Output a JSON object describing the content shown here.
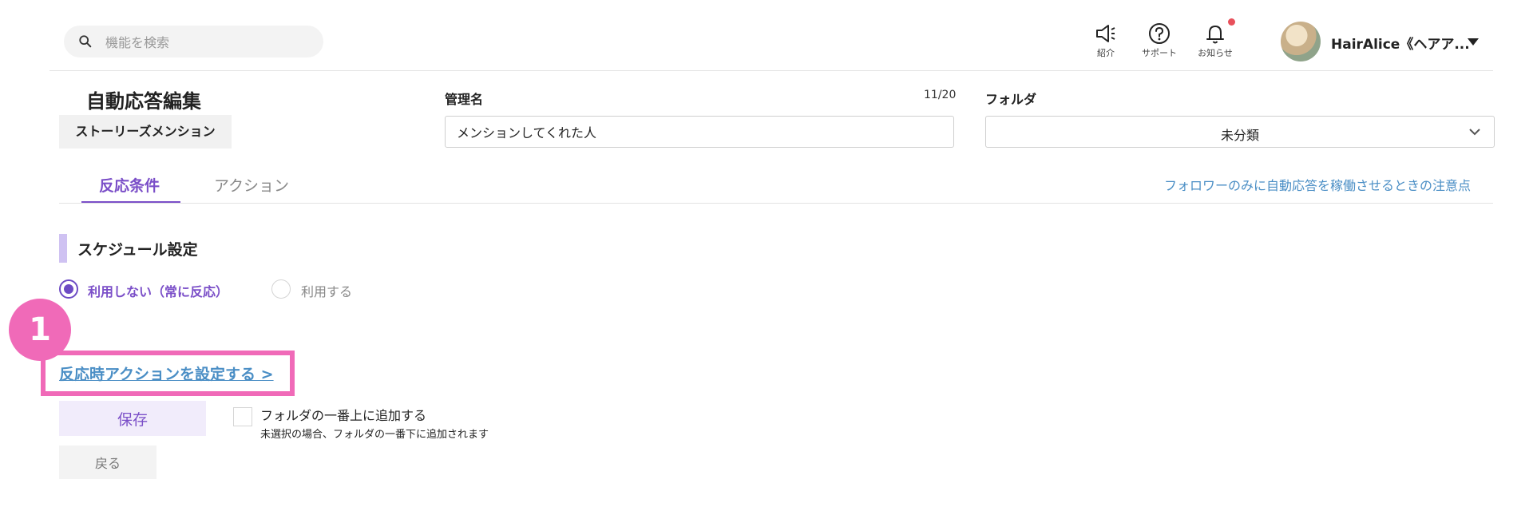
{
  "header": {
    "search_placeholder": "機能を検索",
    "nav": [
      {
        "label": "紹介",
        "icon": "megaphone-icon"
      },
      {
        "label": "サポート",
        "icon": "help-icon"
      },
      {
        "label": "お知らせ",
        "icon": "bell-icon"
      }
    ],
    "user_name": "HairAlice《ヘアア...",
    "notification_dot_color": "#e8505b"
  },
  "editor": {
    "title": "自動応答編集",
    "type_badge": "ストーリーズメンション",
    "name_label": "管理名",
    "name_counter": "11/20",
    "name_value": "メンションしてくれた人",
    "folder_label": "フォルダ",
    "folder_value": "未分類"
  },
  "tabs": [
    {
      "label": "反応条件",
      "active": true
    },
    {
      "label": "アクション",
      "active": false
    }
  ],
  "help_link": "フォロワーのみに自動応答を稼働させるときの注意点",
  "schedule": {
    "title": "スケジュール設定",
    "options": [
      {
        "label": "利用しない（常に反応）",
        "selected": true
      },
      {
        "label": "利用する",
        "selected": false
      }
    ]
  },
  "annotation": {
    "marker": "1",
    "color": "#f06ab8"
  },
  "action_link": "反応時アクションを設定する >",
  "footer": {
    "save_label": "保存",
    "checkbox_label": "フォルダの一番上に追加する",
    "checkbox_note": "未選択の場合、フォルダの一番下に追加されます",
    "back_label": "戻る"
  },
  "colors": {
    "accent": "#7b4fc8",
    "link": "#4a8ec5",
    "highlight": "#f06ab8"
  }
}
